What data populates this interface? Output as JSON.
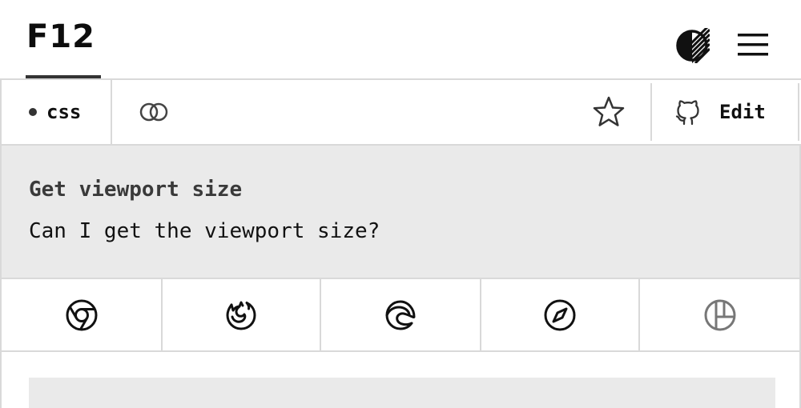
{
  "header": {
    "logo": "F12",
    "theme_icon": "contrast-icon",
    "menu_icon": "hamburger-menu-icon"
  },
  "toolbar": {
    "tag_label": "css",
    "link_icon": "link-icon",
    "star_icon": "star-icon",
    "edit_icon": "github-icon",
    "edit_label": "Edit"
  },
  "snippet": {
    "title": "Get viewport size",
    "question": "Can I get the viewport size?"
  },
  "browsers": [
    {
      "icon": "chrome-icon",
      "supported": true
    },
    {
      "icon": "firefox-icon",
      "supported": true
    },
    {
      "icon": "edge-icon",
      "supported": true
    },
    {
      "icon": "safari-icon",
      "supported": true
    },
    {
      "icon": "other-browser-icon",
      "supported": false
    }
  ],
  "colors": {
    "text": "#111111",
    "border": "#d9d9d9",
    "panel_bg": "#eaeaea",
    "muted_icon": "#777777"
  }
}
